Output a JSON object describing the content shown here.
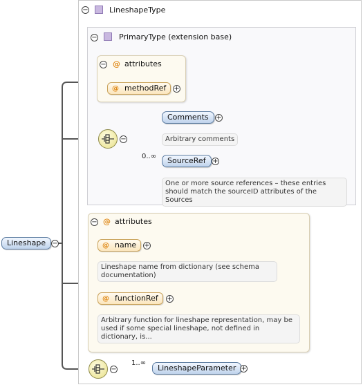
{
  "root": {
    "label": "Lineshape"
  },
  "type_box": {
    "title": "LineshapeType"
  },
  "extension_box": {
    "title": "PrimaryType (extension base)"
  },
  "ext_attributes": {
    "title": "attributes",
    "items": [
      {
        "name": "methodRef"
      }
    ]
  },
  "sequence1": {
    "elements": [
      {
        "name": "Comments",
        "doc": "Arbitrary comments"
      },
      {
        "name": "SourceRef",
        "cardinality": "0..∞",
        "doc": "One or more source references – these entries should match the sourceID attributes of the Sources"
      }
    ]
  },
  "own_attributes": {
    "title": "attributes",
    "items": [
      {
        "name": "name",
        "doc": "Lineshape name from dictionary (see schema documentation)"
      },
      {
        "name": "functionRef",
        "doc": "Arbitrary function for lineshape representation, may be used if some special lineshape, not defined in dictionary, is..."
      }
    ]
  },
  "sequence2": {
    "element": "LineshapeParameter",
    "cardinality": "1..∞"
  },
  "symbols": {
    "collapse": "−",
    "expand": "+",
    "attribute": "@"
  },
  "icons": [
    "collapse-icon",
    "expand-icon",
    "complex-type-icon",
    "attribute-icon",
    "sequence-icon"
  ]
}
